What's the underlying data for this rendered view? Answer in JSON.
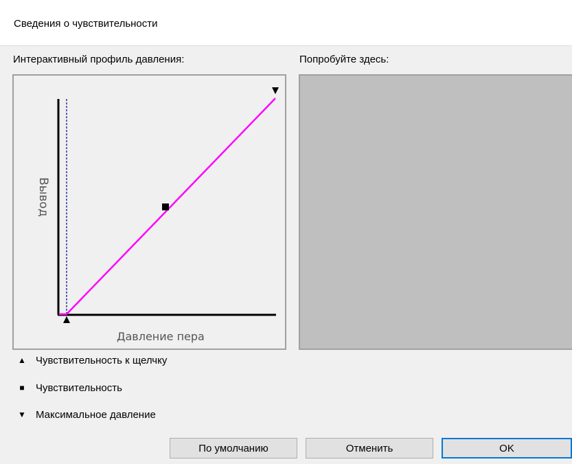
{
  "window": {
    "title": "Сведения о чувствительности"
  },
  "profile": {
    "label": "Интерактивный профиль давления:",
    "y_axis_label": "Вывод",
    "x_axis_label": "Давление пера",
    "curve_color": "#ff00ff",
    "threshold_color": "#00008b"
  },
  "try_area": {
    "label": "Попробуйте здесь:",
    "background": "#bfbfbf"
  },
  "legend": {
    "items": [
      {
        "symbol": "▲",
        "label": "Чувствительность к щелчку"
      },
      {
        "symbol": "■",
        "label": "Чувствительность"
      },
      {
        "symbol": "▼",
        "label": "Максимальное давление"
      }
    ]
  },
  "buttons": {
    "default_label": "По умолчанию",
    "cancel_label": "Отменить",
    "ok_label": "OK",
    "accent": "#0078d7"
  }
}
